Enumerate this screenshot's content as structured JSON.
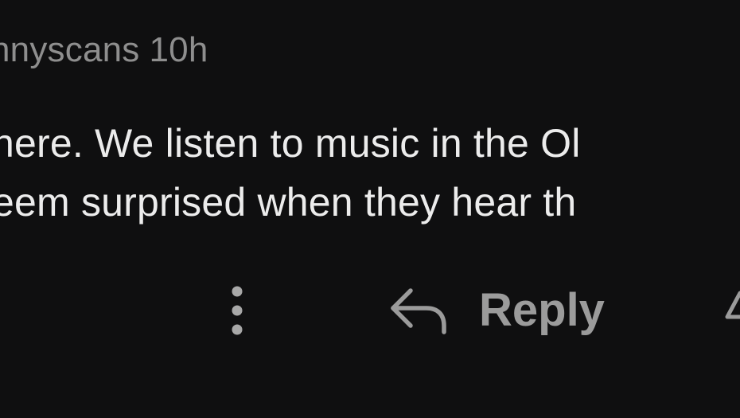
{
  "comment": {
    "author": "nnyscans",
    "time": "10h",
    "lines": [
      "here. We listen to music in the Ol",
      "eem surprised when they hear th"
    ]
  },
  "actions": {
    "more_icon": "more-vertical-icon",
    "reply_icon": "reply-arrow-icon",
    "reply_label": "Reply"
  },
  "colors": {
    "background": "#0f0f10",
    "text": "#ececec",
    "muted": "#8e8e8e",
    "action": "#9b9b9b"
  }
}
